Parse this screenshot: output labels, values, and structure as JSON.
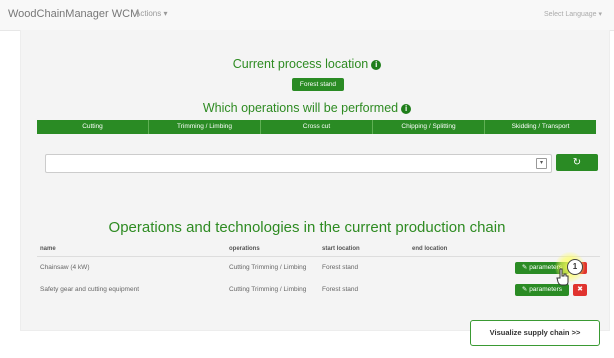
{
  "navbar": {
    "brand": "WoodChainManager WCM",
    "actions": "Actions",
    "language": "Select Language"
  },
  "process": {
    "title": "Current process location",
    "location_button": "Forest stand"
  },
  "operations": {
    "title": "Which operations will be performed",
    "items": [
      "Cutting",
      "Trimming / Limbing",
      "Cross cut",
      "Chipping / Splitting",
      "Skidding / Transport"
    ]
  },
  "chain": {
    "title": "Operations and technologies in the current production chain",
    "columns": [
      "name",
      "operations",
      "start location",
      "end location"
    ],
    "rows": [
      {
        "name": "Chainsaw (4 kW)",
        "operations": "Cutting  Trimming / Limbing",
        "start": "Forest stand",
        "end": "",
        "params_label": "parameters"
      },
      {
        "name": "Safety gear and cutting equipment",
        "operations": "Cutting  Trimming / Limbing",
        "start": "Forest stand",
        "end": "",
        "params_label": "parameters"
      }
    ]
  },
  "visualize_button": "Visualize supply chain >>",
  "step_badge": "1",
  "colors": {
    "primary_green": "#2a8b24",
    "danger_red": "#e0332f"
  }
}
